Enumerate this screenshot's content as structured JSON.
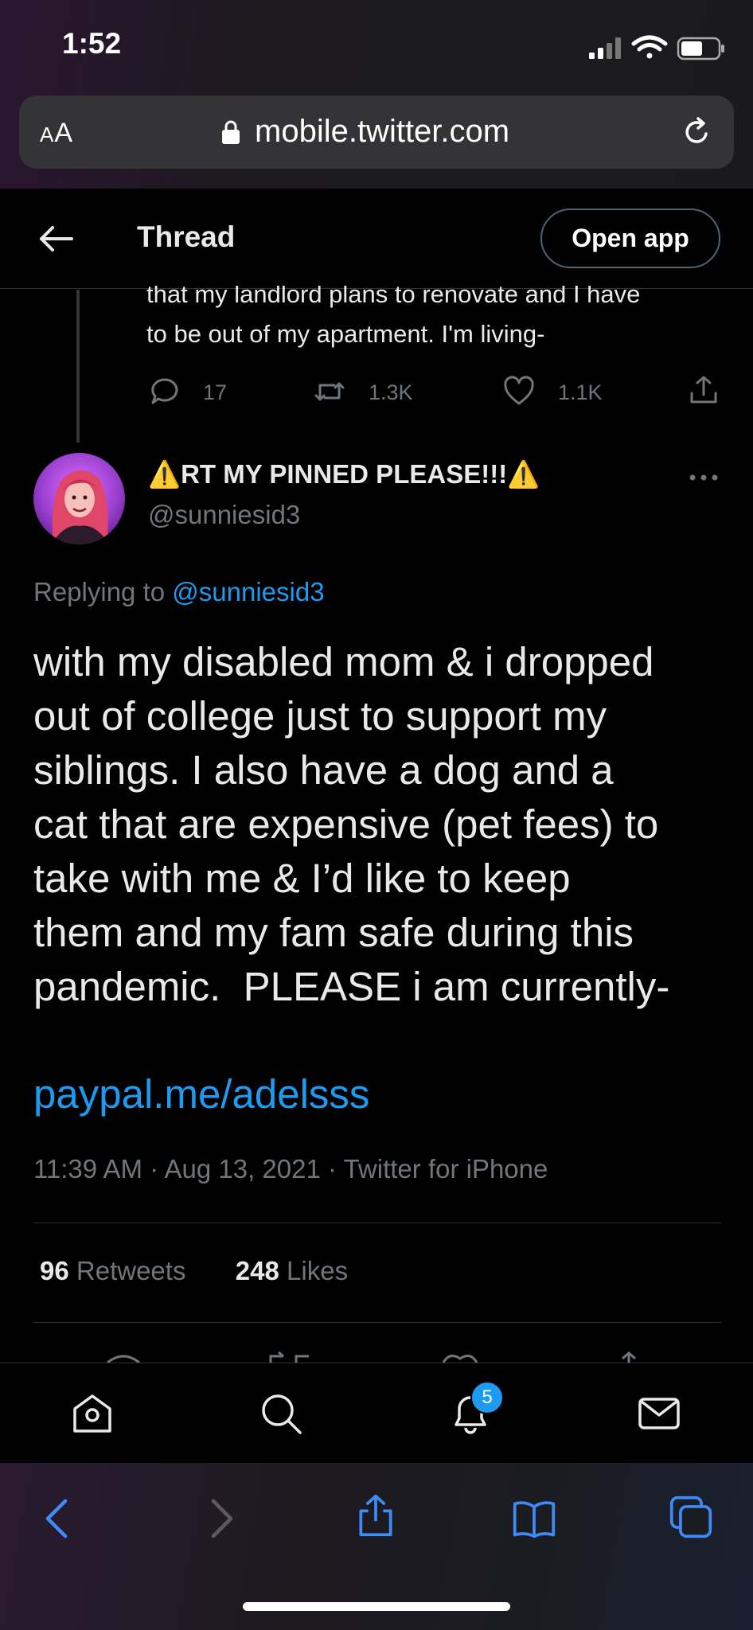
{
  "status_bar": {
    "time": "1:52"
  },
  "browser": {
    "aa_label_small": "A",
    "aa_label": "A",
    "url": "mobile.twitter.com"
  },
  "header": {
    "title": "Thread",
    "open_app_label": "Open app"
  },
  "previous_tweet": {
    "text_line1": "that my landlord plans to renovate and I have",
    "text_line2": "to be out of my apartment. I'm living-",
    "replies": "17",
    "retweets": "1.3K",
    "likes": "1.1K"
  },
  "tweet": {
    "display_name": "RT MY PINNED PLEASE!!!",
    "warning_emoji": "⚠️",
    "handle": "@sunniesid3",
    "replying_prefix": "Replying to ",
    "replying_to": "@sunniesid3",
    "body": "with my disabled mom & i dropped\nout of college just to support my\nsiblings. I also have a dog and a\ncat that are expensive (pet fees) to\ntake with me & I’d like to keep\nthem and my fam safe during this\npandemic.  PLEASE i am currently-",
    "link": "paypal.me/adelsss",
    "time": "11:39 AM",
    "date": "Aug 13, 2021",
    "source": "Twitter for iPhone",
    "meta_separator": " · ",
    "retweet_count": "96",
    "retweet_label": " Retweets",
    "like_count": "248",
    "like_label": " Likes"
  },
  "bottom_nav": {
    "notifications_badge": "5"
  },
  "colors": {
    "accent": "#1d9bf0",
    "muted": "#71767b",
    "text": "#e7e9ea",
    "border": "#2f3336"
  },
  "icons": [
    "back-arrow-icon",
    "lock-icon",
    "reload-icon",
    "reply-icon",
    "retweet-icon",
    "like-icon",
    "share-icon",
    "more-icon",
    "home-icon",
    "search-icon",
    "bell-icon",
    "mail-icon",
    "safari-back-icon",
    "safari-forward-icon",
    "safari-share-icon",
    "bookmarks-icon",
    "tabs-icon"
  ]
}
